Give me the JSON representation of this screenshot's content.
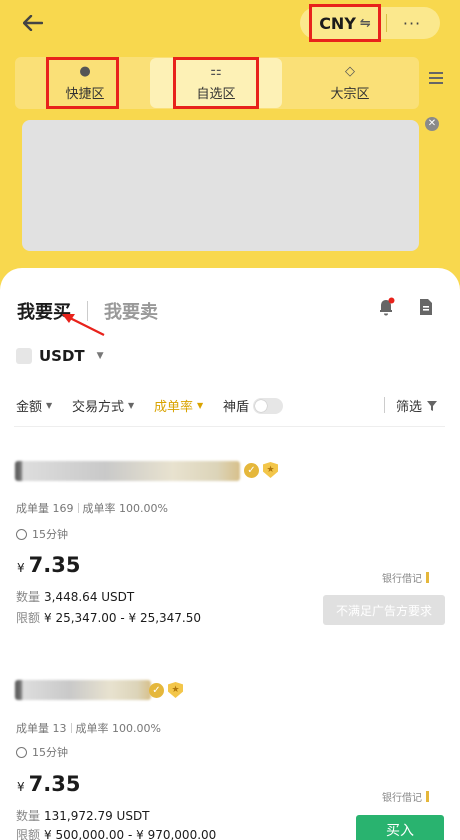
{
  "header": {
    "currency": "CNY",
    "more_label": "···"
  },
  "tabs": [
    {
      "label": "快捷区",
      "icon": "person-icon"
    },
    {
      "label": "自选区",
      "icon": "coins-icon"
    },
    {
      "label": "大宗区",
      "icon": "diamond-icon"
    }
  ],
  "trade": {
    "buy_label": "我要买",
    "sell_label": "我要卖",
    "coin": "USDT"
  },
  "filters": {
    "amount": "金额",
    "payment": "交易方式",
    "completion": "成单率",
    "shield": "神盾",
    "screen": "筛选"
  },
  "ads": [
    {
      "orders_label": "成单量 169",
      "rate_label": "成单率 100.00%",
      "time": "15分钟",
      "currency_symbol": "¥",
      "price": "7.35",
      "quantity_label": "数量",
      "quantity": "3,448.64 USDT",
      "limit_label": "限额",
      "limit": "¥ 25,347.00 - ¥ 25,347.50",
      "payment": "银行借记",
      "action": "不满足广告方要求"
    },
    {
      "orders_label": "成单量 13",
      "rate_label": "成单率 100.00%",
      "time": "15分钟",
      "currency_symbol": "¥",
      "price": "7.35",
      "quantity_label": "数量",
      "quantity": "131,972.79 USDT",
      "limit_label": "限额",
      "limit": "¥ 500,000.00 - ¥ 970,000.00",
      "payment": "银行借记",
      "action": "买入"
    }
  ],
  "colors": {
    "brand_yellow": "#F8D84E",
    "highlight_red": "#E8221B",
    "accent_gold": "#D9A300",
    "buy_green": "#29B36F"
  }
}
